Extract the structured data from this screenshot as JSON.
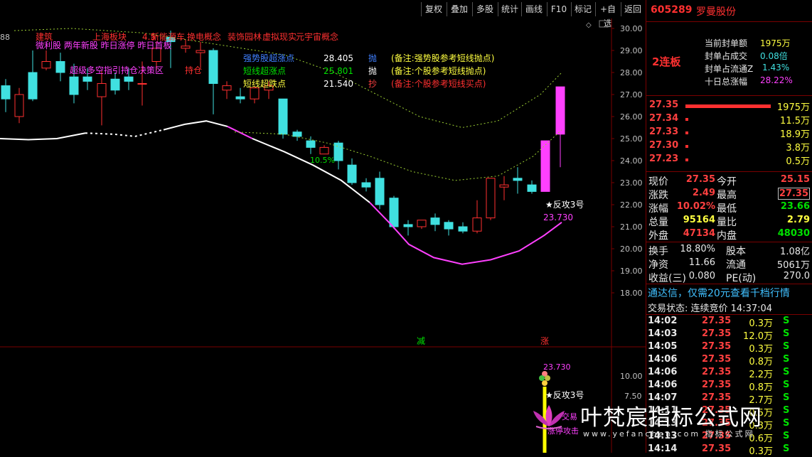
{
  "toolbar": {
    "buttons": [
      "复权",
      "叠加",
      "多股",
      "统计",
      "画线",
      "F10",
      "标记",
      "+自选",
      "返回"
    ]
  },
  "stock": {
    "code": "605289",
    "name": "罗曼股份"
  },
  "concepts_line1": [
    "建筑",
    "上海板块",
    "4.5",
    "新能源车",
    "换电概念",
    "装饰园林",
    "虚拟现实",
    "元宇宙概念"
  ],
  "concepts_line2": "微利股 两年新股 昨日涨停 昨日首板",
  "strategy_note": "超级多空指引持仓决策区",
  "hold_label": "持仓",
  "left_marker": "88",
  "signals": [
    {
      "label": "强势股超涨点",
      "value": "28.405",
      "action": "抛",
      "note": "(备注:强势股参考短线抛点)",
      "color": "#4080ff"
    },
    {
      "label": "短线超涨点",
      "value": "25.801",
      "action": "抛",
      "note": "(备注:个股参考短线抛点)",
      "color": "#00e000"
    },
    {
      "label": "短线超跌点",
      "value": "21.540",
      "action": "抄",
      "note": "(备注:个股参考短线买点)",
      "color": "#ffff40"
    }
  ],
  "signal_action_colors": [
    "#4080ff",
    "#ffffff",
    "#ff4040"
  ],
  "annotations": {
    "pct": "10.5%",
    "counter_attack": "★反攻3号",
    "price_low": "23.730",
    "jian": "减",
    "zhang": "涨"
  },
  "y_axis_main": [
    "30.00",
    "29.00",
    "28.00",
    "27.00",
    "26.00",
    "25.00",
    "24.00",
    "23.00",
    "22.00",
    "21.00",
    "20.00",
    "19.00",
    "18.00"
  ],
  "y_axis_sub": [
    "10.00",
    "7.50"
  ],
  "sub_labels": {
    "price": "23.730",
    "counter_attack": "★反攻3号",
    "jiaoyi": "交易",
    "limit_attack": "涨停攻击"
  },
  "watermark": {
    "title": "叶梵宸指标公式网",
    "url": "www.yefanchen.com  指标公式网"
  },
  "panel": {
    "seal_amount_label": "当前封单额",
    "seal_amount": "1975万",
    "seal_ratio_label": "封单占成交",
    "seal_ratio": "0.08倍",
    "seal_float_label": "封单占流通Z",
    "seal_float": "1.43%",
    "ten_day_label": "十日总涨幅",
    "ten_day": "28.22%",
    "board": "2连板"
  },
  "orderbook": [
    {
      "price": "27.35",
      "vol": "1975万",
      "bar": 1.0
    },
    {
      "price": "27.34",
      "vol": "11.5万",
      "bar": 0.0
    },
    {
      "price": "27.33",
      "vol": "18.9万",
      "bar": 0.0
    },
    {
      "price": "27.30",
      "vol": "3.8万",
      "bar": 0.0
    },
    {
      "price": "27.23",
      "vol": "0.5万",
      "bar": 0.0
    }
  ],
  "quote": [
    [
      "现价",
      "27.35",
      "今开",
      "25.15"
    ],
    [
      "涨跌",
      "2.49",
      "最高",
      "27.35"
    ],
    [
      "涨幅",
      "10.02%",
      "最低",
      "23.66"
    ],
    [
      "总量",
      "95164",
      "量比",
      "2.79"
    ],
    [
      "外盘",
      "47134",
      "内盘",
      "48030"
    ]
  ],
  "fundamentals": [
    [
      "换手",
      "18.80%",
      "股本",
      "1.08亿"
    ],
    [
      "净资",
      "11.66",
      "流通",
      "5061万"
    ],
    [
      "收益(三)",
      "0.080",
      "PE(动)",
      "270.0"
    ]
  ],
  "promo": "通达信，仅需20元查看千档行情",
  "trade_status": "交易状态: 连续竞价 14:37:04",
  "ticks": [
    [
      "14:02",
      "27.35",
      "0.3万",
      "S"
    ],
    [
      "14:03",
      "27.35",
      "12.0万",
      "S"
    ],
    [
      "14:05",
      "27.35",
      "0.3万",
      "S"
    ],
    [
      "14:06",
      "27.35",
      "0.8万",
      "S"
    ],
    [
      "14:06",
      "27.35",
      "2.2万",
      "S"
    ],
    [
      "14:06",
      "27.35",
      "0.8万",
      "S"
    ],
    [
      "14:07",
      "27.35",
      "2.7万",
      "S"
    ],
    [
      "14:11",
      "27.35",
      "0.5万",
      "S"
    ],
    [
      "14:13",
      "27.35",
      "0.3万",
      "S"
    ],
    [
      "14:13",
      "27.35",
      "0.6万",
      "S"
    ],
    [
      "14:14",
      "27.35",
      "0.3万",
      "S"
    ]
  ]
}
